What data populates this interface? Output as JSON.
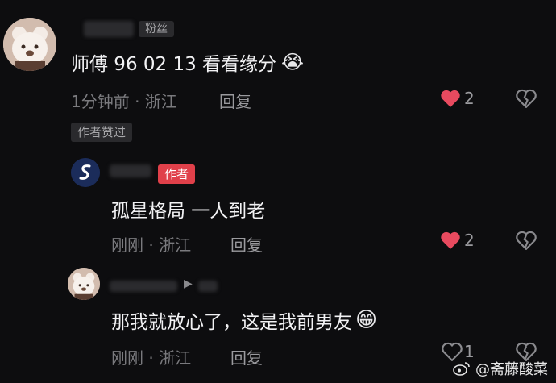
{
  "comments": [
    {
      "badge": "粉丝",
      "text": "师傅 96  02 13 看看缘分",
      "emoji": "😭",
      "time_location": "1分钟前 · 浙江",
      "reply_label": "回复",
      "likes": "2",
      "liked_by_author_label": "作者赞过"
    },
    {
      "badge": "作者",
      "text": "孤星格局  一人到老",
      "time_location": "刚刚 · 浙江",
      "reply_label": "回复",
      "likes": "2"
    },
    {
      "text": "那我就放心了，这是我前男友",
      "emoji": "😁",
      "time_location": "刚刚 · 浙江",
      "reply_label": "回复",
      "likes": "1"
    }
  ],
  "watermark": {
    "text": "@斋藤酸菜",
    "icon": "weibo-icon"
  },
  "colors": {
    "background": "#0d0d0f",
    "like_active": "#e84a5f",
    "author_tag": "#e0404a"
  }
}
